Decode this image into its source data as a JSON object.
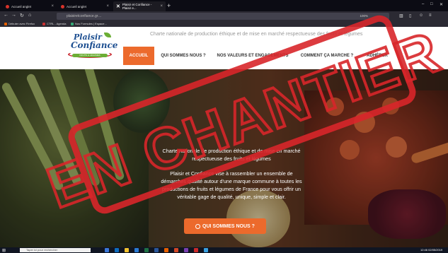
{
  "browser": {
    "tabs": [
      {
        "label": "Accueil anglet",
        "active": false
      },
      {
        "label": "Accueil anglet",
        "active": false
      },
      {
        "label": "Plaisir et Confiance - Plaisir e...",
        "active": true
      }
    ],
    "new_tab": "+",
    "url": "plaisiretconfiance.gr…",
    "zoom": "100%",
    "bookmarks": [
      "Débuter avec Firefox",
      "CTRL - Agenda",
      "Nos Formules | Espace..."
    ]
  },
  "site": {
    "logo": {
      "line1": "Plaisir",
      "line2": "Confiance",
      "band": "FRUITS & LÉGUMES"
    },
    "tagline": "Charte nationale de production éthique et de mise en marché respectueuse des fruits et légumes",
    "nav": [
      {
        "label": "ACCUEIL",
        "active": true
      },
      {
        "label": "QUI SOMMES NOUS ?",
        "active": false
      },
      {
        "label": "NOS VALEURS ET ENGAGEMENTS",
        "active": false
      },
      {
        "label": "COMMENT ÇA MARCHE ?",
        "active": false
      },
      {
        "label": "ADHÉRER",
        "active": false
      }
    ]
  },
  "hero": {
    "title": "Charte nationale de production éthique et de mise en marché respectueuse des fruits et légumes",
    "description": "Plaisir et Confiance vise à rassembler un ensemble de démarches qualité autour d'une marque commune à toutes les productions de fruits et légumes de France pour vous offrir un véritable gage de qualité, unique, simple et clair.",
    "button": "QUI SOMMES NOUS ?"
  },
  "stamp": {
    "text": "EN CHANTIER",
    "color": "#d8262a"
  },
  "taskbar": {
    "search_placeholder": "Taper ici pour rechercher",
    "time": "12:46",
    "date": "02/05/2019"
  },
  "colors": {
    "accent": "#ec6a2c",
    "brand_blue": "#1d4f91",
    "brand_green": "#6cae35",
    "stamp_red": "#d8262a"
  }
}
